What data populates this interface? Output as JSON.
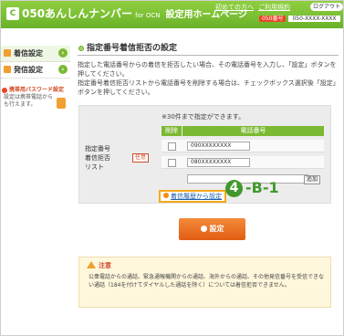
{
  "header": {
    "logo_mark": "C",
    "brand": "050あんしんナンバー",
    "brand_for": "for OCN",
    "subtitle": "設定用ホームページ",
    "link_first": "初めての方へ",
    "link_faq": "ご利用規約",
    "logout": "ログアウト",
    "number_tag": "050番号",
    "number_value": "050-XXXX-XXXX"
  },
  "sidebar": {
    "items": [
      {
        "label": "着信設定"
      },
      {
        "label": "発信設定"
      }
    ],
    "password_title": "携帯用パスワード設定",
    "password_desc": "設定は携帯電話からも行えます。"
  },
  "main": {
    "title": "指定番号着信拒否の設定",
    "desc1": "指定した電話番号からの着信を拒否したい場合、その電話番号を入力し、「設定」ボタンを押してください。",
    "desc2": "指定番号着信拒否リストから電話番号を削除する場合は、チェックボックス選択後「設定」ボタンを押してください。",
    "form_label": "指定番号\n着信拒否\nリスト",
    "required": "任意",
    "note_30": "※30件まで指定ができます。",
    "col_delete": "削除",
    "col_phone": "電話番号",
    "rows": [
      {
        "value": "090XXXXXXXX"
      },
      {
        "value": "080XXXXXXXX"
      },
      {
        "value": ""
      }
    ],
    "add_button": "追加",
    "history_link": "着信履歴から設定",
    "callout_num": "4",
    "callout_text": "-B-1",
    "set_button": "設定",
    "caution_title": "注意",
    "caution_body": "公衆電話からの通話、緊急通報機関からの通話、海外からの通話、その他発信番号を受信できない通話（184を付けてダイヤルした通話を除く）については着信拒否できません。"
  }
}
